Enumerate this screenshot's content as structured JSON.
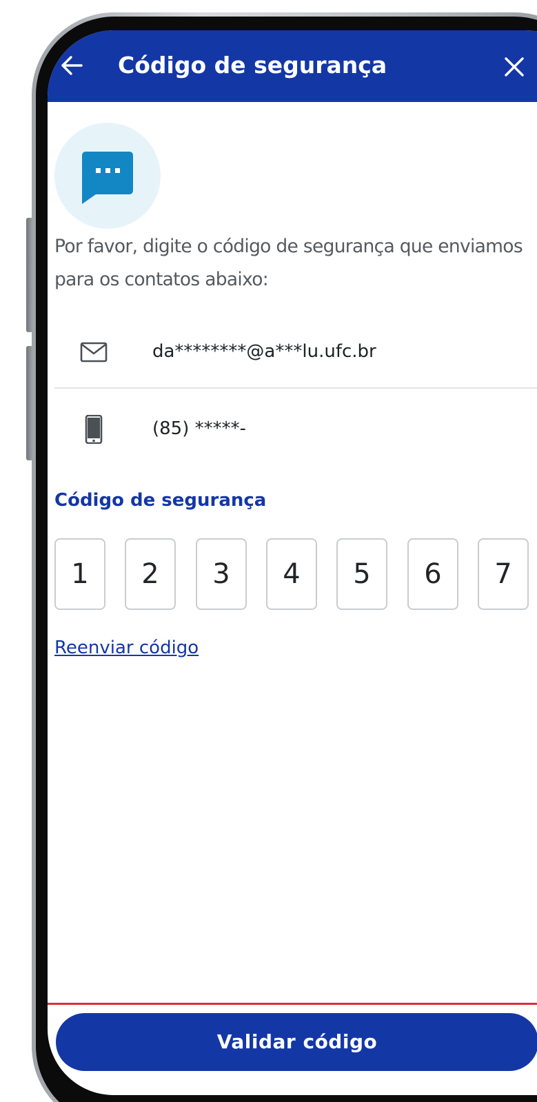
{
  "header": {
    "title": "Código de segurança",
    "back_icon": "arrow-left-icon",
    "close_icon": "close-icon",
    "background_color": "#1437a6"
  },
  "intro": {
    "icon": "chat-bubble-icon",
    "text": "Por favor, digite o código de segurança que enviamos para os contatos abaixo:"
  },
  "contacts": [
    {
      "type": "email",
      "icon": "envelope-icon",
      "value": "da********@a***lu.ufc.br"
    },
    {
      "type": "phone",
      "icon": "smartphone-icon",
      "value": "(85) *****-"
    }
  ],
  "code": {
    "label": "Código de segurança",
    "digits": [
      "1",
      "2",
      "3",
      "4",
      "5",
      "6",
      "7"
    ]
  },
  "resend_link": "Reenviar código",
  "submit_button": "Validar código",
  "colors": {
    "primary": "#1437a6",
    "accent_red": "#d7313c",
    "chat_icon": "#1287c4",
    "chat_circle": "#e6f4fa"
  }
}
